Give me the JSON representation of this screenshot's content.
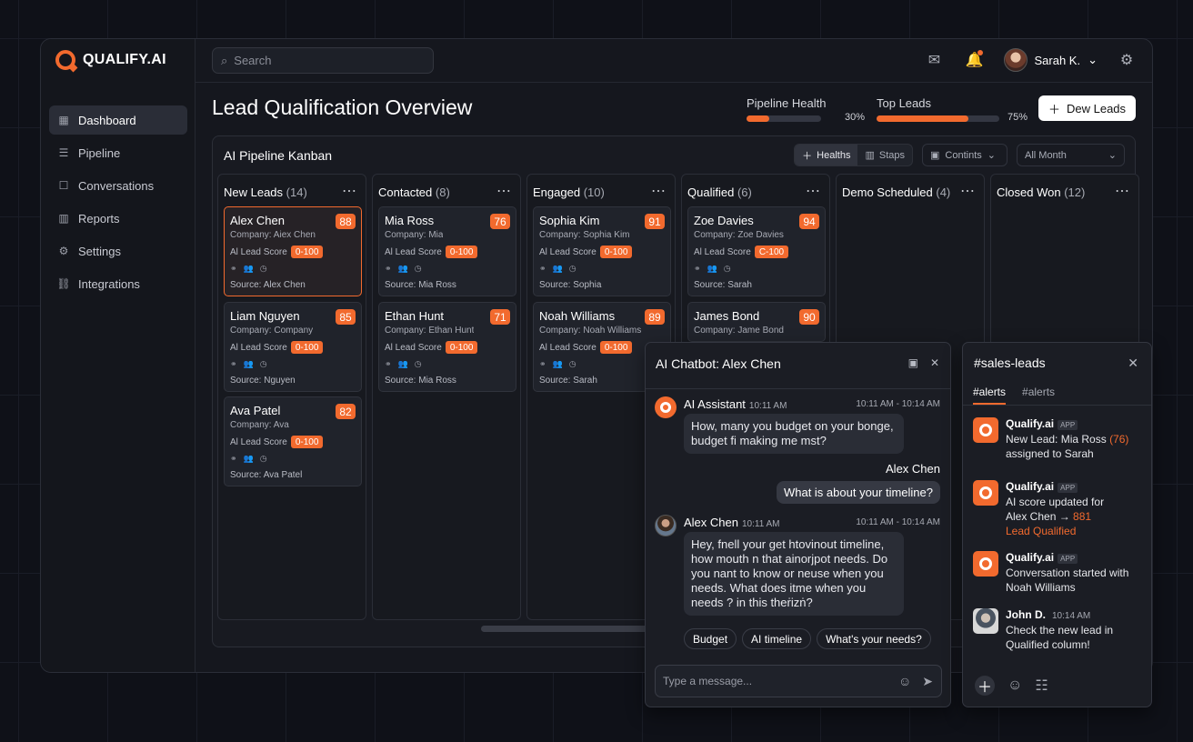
{
  "app": {
    "brand": "QUALIFY.AI",
    "title": "Lead Qualification Overview"
  },
  "search": {
    "placeholder": "Search"
  },
  "user": {
    "name": "Sarah K."
  },
  "sidebar": {
    "items": [
      {
        "label": "Dashboard",
        "icon": "grid-icon",
        "active": true
      },
      {
        "label": "Pipeline",
        "icon": "list-icon"
      },
      {
        "label": "Conversations",
        "icon": "chat-icon"
      },
      {
        "label": "Reports",
        "icon": "report-icon"
      },
      {
        "label": "Settings",
        "icon": "gear-icon"
      },
      {
        "label": "Integrations",
        "icon": "link-icon"
      }
    ]
  },
  "metrics": {
    "pipeline": {
      "label": "Pipeline Health",
      "pct_text": "30%",
      "value": 0.3
    },
    "top": {
      "label": "Top Leads",
      "pct_text": "75%",
      "value": 0.75
    }
  },
  "actions": {
    "new_leads": "Dew Leads"
  },
  "board": {
    "title": "AI Pipeline Kanban",
    "controls": {
      "health": "Healths",
      "steps": "Staps",
      "contacts": "Contints",
      "period": "All Month"
    }
  },
  "columns": [
    {
      "name": "New Leads",
      "count": "(14)"
    },
    {
      "name": "Contacted",
      "count": "(8)"
    },
    {
      "name": "Engaged",
      "count": "(10)"
    },
    {
      "name": "Qualified",
      "count": "(6)"
    },
    {
      "name": "Demo Scheduled",
      "count": "(4)"
    },
    {
      "name": "Closed Won",
      "count": "(12)"
    }
  ],
  "cards": [
    {
      "name": "Alex Chen",
      "score": "88",
      "company": "Company: Aiex Chen",
      "source": "Source: Alex Chen",
      "selected": true
    },
    {
      "name": "Liam Nguyen",
      "score": "85",
      "company": "Company: Company",
      "source": "Source: Nguyen"
    },
    {
      "name": "Ava Patel",
      "score": "82",
      "company": "Company: Ava",
      "source": "Source: Ava Patel"
    },
    {
      "name": "Mia Ross",
      "score": "76",
      "company": "Company: Mia",
      "source": "Source: Mia Ross"
    },
    {
      "name": "Ethan Hunt",
      "score": "71",
      "company": "Company: Ethan Hunt",
      "source": "Source: Mia Ross"
    },
    {
      "name": "Sophia Kim",
      "score": "91",
      "company": "Company: Sophia Kim",
      "source": "Source: Sophia"
    },
    {
      "name": "Noah Williams",
      "score": "89",
      "company": "Company: Noah Williams",
      "source": "Source: Sarah"
    },
    {
      "name": "Zoe Davies",
      "score": "94",
      "company": "Company: Zoe Davies",
      "source": "Source: Sarah"
    },
    {
      "name": "James Bond",
      "score": "90",
      "company": "Company: Jame Bond",
      "source": ""
    }
  ],
  "card_labels": {
    "lead_score": "Al Lead Score",
    "score_tags": [
      "0-100",
      "0-100",
      "0-100",
      "0-100",
      "0-100",
      "0-100",
      "0-100",
      "C-100"
    ]
  },
  "chat": {
    "title": "AI Chatbot: Alex Chen",
    "bot_name": "AI Assistant",
    "bot_time": "10:11 AM",
    "time_range": "10:11 AM - 10:14 AM",
    "bot_msg": "How, many you budget on your bonge, budget ﬁ making me mst?",
    "user_label": "Alex Chen",
    "user_msg": "What is about your timeline?",
    "alex_time": "10:11 AM",
    "time_range2": "10:11 AM - 10:14 AM",
    "alex_msg": "Hey, fnell your get htovinout timeline, how mouth n that ainorjpot needs. Do you nant to know or neuse when you needs. What does itme when you needs ? in this theṙizṅ?",
    "chips": [
      "Budget",
      "AI timeline",
      "What's your needs?"
    ],
    "placeholder": "Type a message..."
  },
  "slack": {
    "title": "#sales-leads",
    "tabs": [
      "#alerts",
      "#alerts"
    ],
    "items": [
      {
        "name": "Qualify.ai",
        "tag": "APP",
        "text1": "New Lead: Mia Ross",
        "score": "(76)",
        "text2": "assigned to Sarah"
      },
      {
        "name": "Qualify.ai",
        "tag": "APP",
        "text1": "AI score updated for",
        "text2": "Alex Chen →",
        "score": "881",
        "text3": "Lead Qualified"
      },
      {
        "name": "Qualify.ai",
        "tag": "APP",
        "text1": "Conversation started with",
        "text2": "Noah Williams"
      },
      {
        "name": "John D.",
        "time": "10:14 AM",
        "text1": "Check the new lead in",
        "text2": "Qualified column!"
      }
    ]
  },
  "colors": {
    "accent": "#f26a2e",
    "background": "#0f1118",
    "panel": "#15171e"
  }
}
